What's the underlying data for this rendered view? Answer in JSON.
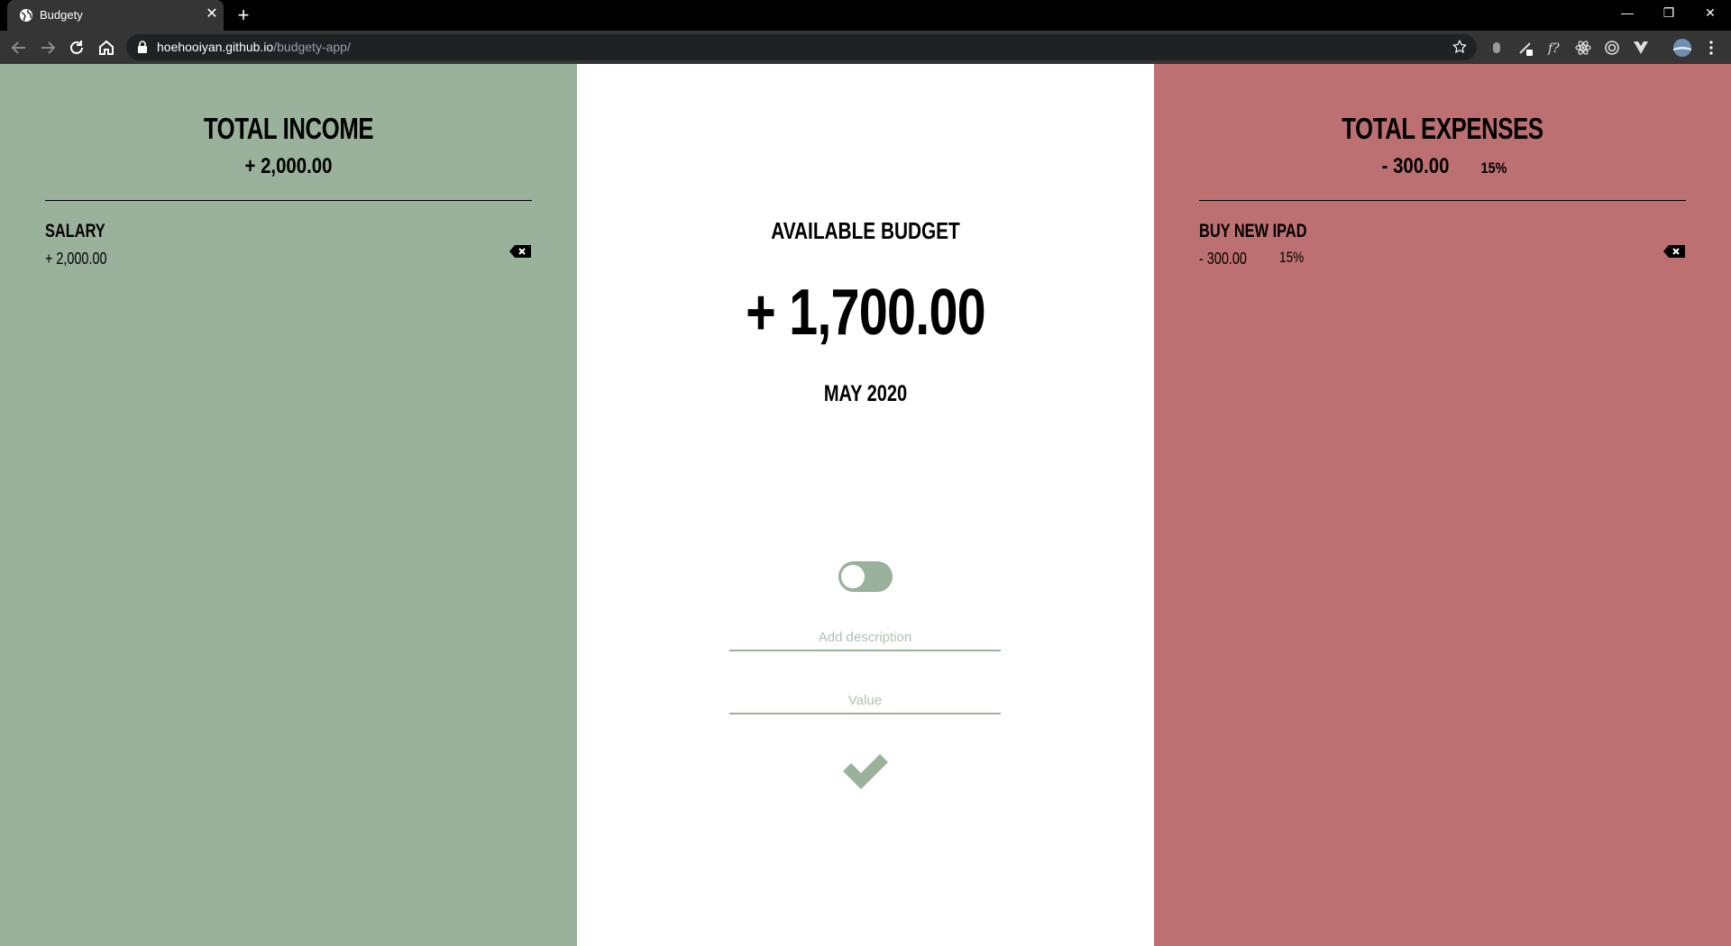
{
  "browser": {
    "tab_title": "Budgety",
    "tab_close": "✕",
    "new_tab": "+",
    "url_host": "hoehooiyan.github.io",
    "url_path": "/budgety-app/",
    "window_controls": [
      "—",
      "❐",
      "✕"
    ]
  },
  "income": {
    "title": "TOTAL INCOME",
    "total": "+ 2,000.00",
    "items": [
      {
        "description": "SALARY",
        "value": "+ 2,000.00"
      }
    ]
  },
  "budget": {
    "title": "AVAILABLE BUDGET",
    "value": "+ 1,700.00",
    "month": "MAY 2020",
    "type_toggle_on": false,
    "description_placeholder": "Add description",
    "value_placeholder": "Value"
  },
  "expenses": {
    "title": "TOTAL EXPENSES",
    "total": "- 300.00",
    "percentage": "15%",
    "items": [
      {
        "description": "BUY NEW IPAD",
        "value": "- 300.00",
        "percentage": "15%"
      }
    ]
  },
  "colors": {
    "income": "#9ab19b",
    "expense": "#bd7071",
    "budget_bg": "#ffffff"
  }
}
